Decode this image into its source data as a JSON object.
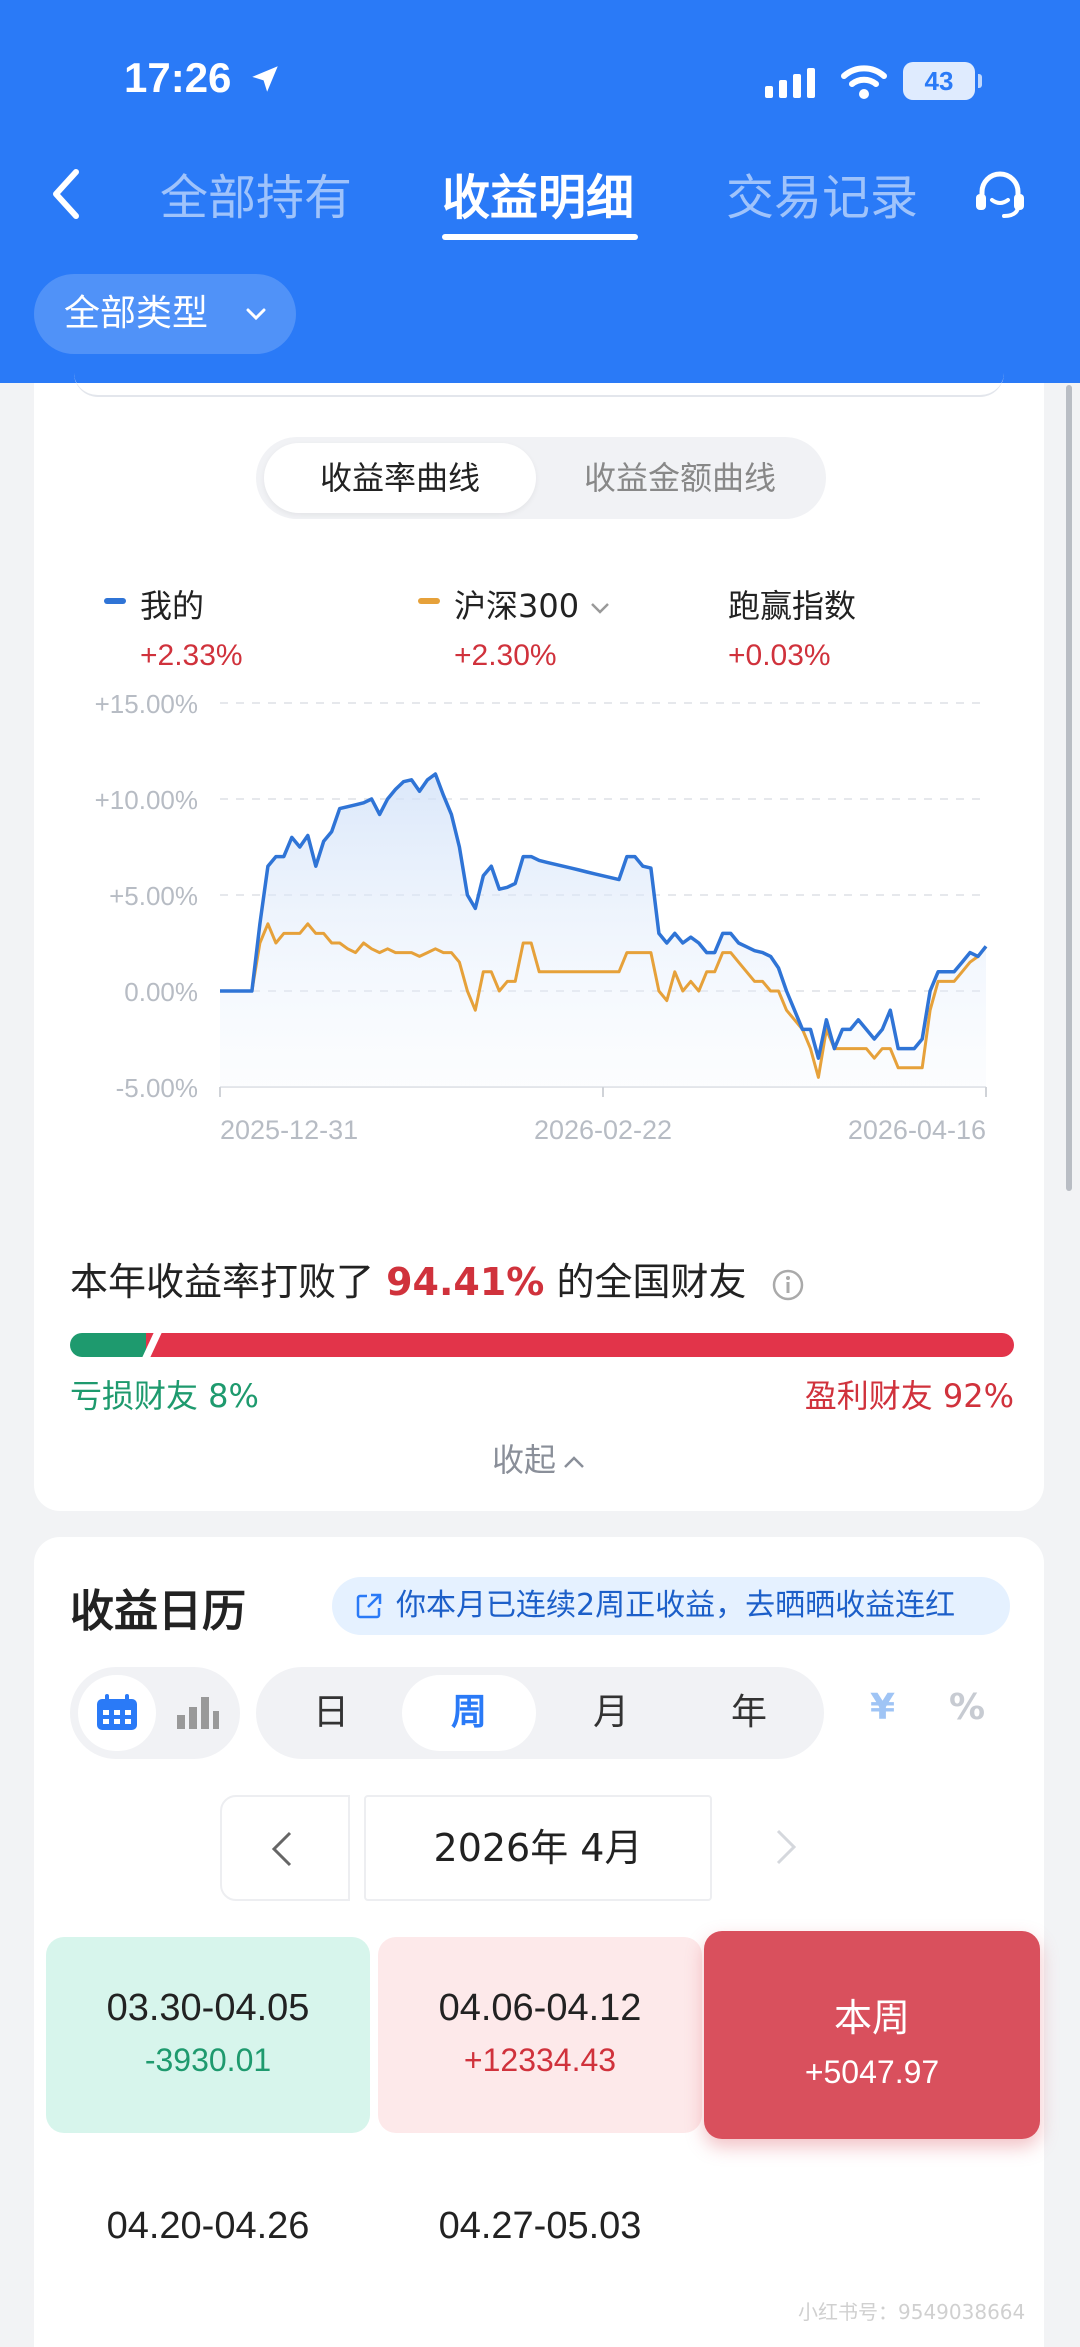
{
  "status_bar": {
    "time": "17:26",
    "battery": "43"
  },
  "nav": {
    "tabs": [
      {
        "label": "全部持有"
      },
      {
        "label": "收益明细"
      },
      {
        "label": "交易记录"
      }
    ],
    "active_tab": "收益明细"
  },
  "filter": {
    "type_label": "全部类型"
  },
  "chart_toggle": {
    "rate_label": "收益率曲线",
    "amount_label": "收益金额曲线"
  },
  "legend": {
    "mine": {
      "name": "我的",
      "value": "+2.33%"
    },
    "benchmark": {
      "name": "沪深300",
      "value": "+2.30%"
    },
    "beat": {
      "name": "跑赢指数",
      "value": "+0.03%"
    }
  },
  "chart_data": {
    "type": "line",
    "ytick_labels": [
      "+15.00%",
      "+10.00%",
      "+5.00%",
      "0.00%",
      "-5.00%"
    ],
    "yticks": [
      15,
      10,
      5,
      0,
      -5
    ],
    "ylim": [
      -5,
      15
    ],
    "xtick_labels": [
      "2025-12-31",
      "2026-02-22",
      "2026-04-16"
    ],
    "grid": true,
    "series": [
      {
        "name": "我的",
        "color": "#2f74d6",
        "values": [
          0,
          0,
          0,
          0,
          0,
          3.5,
          6.5,
          7,
          7,
          8,
          7.5,
          8.1,
          6.5,
          7.8,
          8.3,
          9.5,
          9.6,
          9.7,
          9.8,
          10,
          9.2,
          10,
          10.5,
          10.9,
          11,
          10.4,
          11,
          11.3,
          10.2,
          9.2,
          7.5,
          5,
          4.3,
          6,
          6.5,
          5.3,
          5.4,
          5.6,
          7,
          7,
          6.8,
          6.7,
          6.6,
          6.5,
          6.4,
          6.3,
          6.2,
          6.1,
          6,
          5.9,
          5.8,
          7,
          7,
          6.5,
          6.4,
          3,
          2.5,
          3,
          2.5,
          2.8,
          2.5,
          2,
          2,
          3,
          3,
          2.5,
          2.3,
          2.1,
          2,
          1.8,
          1.2,
          0,
          -1,
          -2,
          -2,
          -3.5,
          -1.5,
          -3,
          -2,
          -2,
          -1.5,
          -2,
          -2.5,
          -2,
          -1,
          -3,
          -3,
          -3,
          -2.5,
          0,
          1,
          1,
          1,
          1.5,
          2,
          1.8,
          2.33
        ]
      },
      {
        "name": "沪深300",
        "color": "#e6a13a",
        "values": [
          0,
          0,
          0,
          0,
          0,
          2.5,
          3.5,
          2.5,
          3,
          3,
          3,
          3.5,
          3,
          3,
          2.5,
          2.5,
          2.2,
          2,
          2.5,
          2.2,
          2,
          2.2,
          2,
          2,
          2,
          1.8,
          2,
          2.2,
          2,
          2,
          1.5,
          0,
          -1,
          1,
          1,
          0,
          0.5,
          0.5,
          2.5,
          2.5,
          1,
          1,
          1,
          1,
          1,
          1,
          1,
          1,
          1,
          1,
          1,
          2,
          2,
          2,
          2,
          0,
          -0.5,
          1,
          0,
          0.5,
          0,
          1,
          1,
          2,
          2,
          1.5,
          1,
          0.5,
          0.5,
          0,
          0,
          -1,
          -1.5,
          -2,
          -3,
          -4.5,
          -2,
          -3,
          -3,
          -3,
          -3,
          -3,
          -3.5,
          -3,
          -3,
          -4,
          -4,
          -4,
          -4,
          -1,
          0.5,
          0.5,
          0.5,
          1,
          1.5,
          1.8,
          2.3
        ]
      }
    ]
  },
  "beat_rank": {
    "prefix": "本年收益率打败了",
    "percent": "94.41%",
    "suffix": "的全国财友"
  },
  "distribution": {
    "loss_label": "亏损财友 8%",
    "gain_label": "盈利财友 92%",
    "loss_fraction": 0.08,
    "gain_fraction": 0.92
  },
  "collapse_label": "收起",
  "calendar": {
    "title": "收益日历",
    "streak_text": "你本月已连续2周正收益，去晒晒收益连红",
    "periods": [
      "日",
      "周",
      "月",
      "年"
    ],
    "active_period": "周",
    "units": [
      "¥",
      "%"
    ],
    "month_label": "2026年 4月",
    "weeks": [
      {
        "range": "03.30-04.05",
        "amount": "-3930.01"
      },
      {
        "range": "04.06-04.12",
        "amount": "+12334.43"
      },
      {
        "range": "本周",
        "amount": "+5047.97"
      },
      {
        "range": "04.20-04.26",
        "amount": ""
      },
      {
        "range": "04.27-05.03",
        "amount": ""
      }
    ]
  },
  "watermark": "小红书号：9549038664"
}
